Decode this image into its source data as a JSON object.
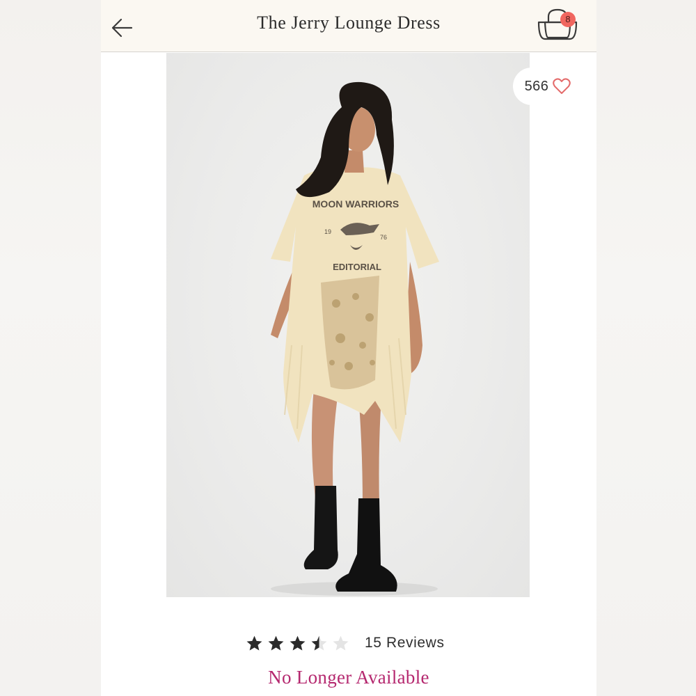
{
  "header": {
    "title": "The Jerry Lounge Dress",
    "back_icon": "arrow-left-icon",
    "cart_icon": "shopping-bag-icon",
    "cart_count": "8"
  },
  "product": {
    "image_alt": "The Jerry Lounge Dress product photo",
    "print_text_top": "MOON WARRIORS",
    "print_text_left": "19",
    "print_text_right": "76",
    "print_text_bottom": "EDITORIAL",
    "likes_count": "566",
    "likes_icon": "heart-outline-icon",
    "rating": 3.5,
    "rating_max": 5,
    "reviews_label": "15 Reviews",
    "availability": "No Longer Available"
  },
  "colors": {
    "accent": "#b5286f",
    "badge": "#f0665f",
    "heart": "#e46a6a",
    "star_filled": "#2b2b2b",
    "star_empty": "#e4e4e4"
  }
}
